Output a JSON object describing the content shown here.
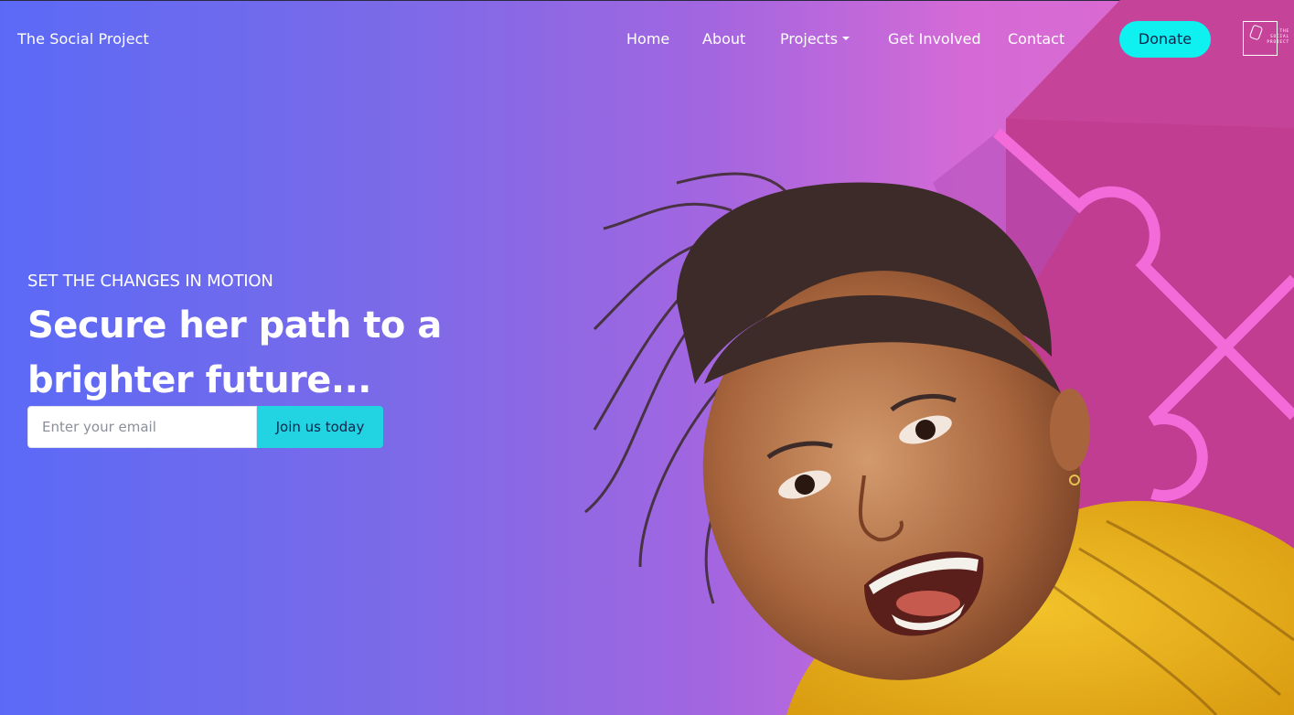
{
  "header": {
    "brand": "The Social Project",
    "nav": [
      {
        "label": "Home"
      },
      {
        "label": "About"
      },
      {
        "label": "Projects",
        "has_dropdown": true
      },
      {
        "label": "Get Involved"
      },
      {
        "label": "Contact"
      }
    ],
    "donate_label": "Donate",
    "logo_text": "THE SOCIAL PROJECT"
  },
  "hero": {
    "eyebrow": "SET THE CHANGES IN MOTION",
    "headline": "Secure her path to a brighter future...",
    "email_placeholder": "Enter your email",
    "join_label": "Join us today"
  },
  "colors": {
    "gradient_start": "#5b6af6",
    "gradient_end": "#e068cc",
    "accent_cyan": "#0ff0f0",
    "deco_magenta": "#c43f94",
    "deco_pink_line": "#f06ad8"
  },
  "icons": {
    "projects_dropdown": "caret-down-icon",
    "logo": "social-project-logo"
  }
}
